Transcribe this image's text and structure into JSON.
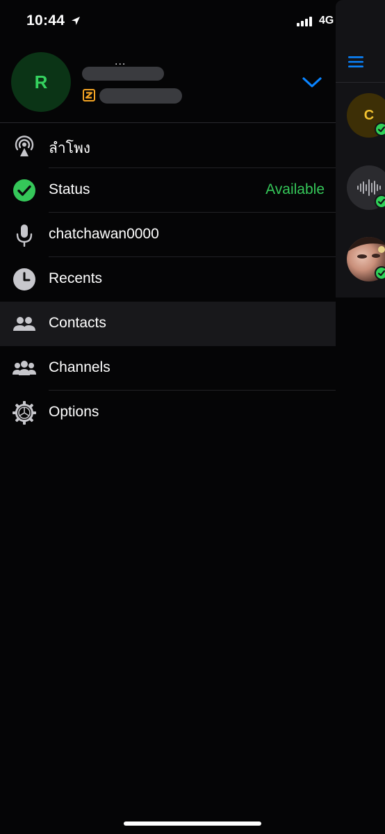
{
  "status_bar": {
    "time": "10:44",
    "network": "4G"
  },
  "profile": {
    "avatar_letter": "R",
    "name_overflow": "...",
    "status_icon": "zoiper-z-icon"
  },
  "menu": {
    "items": [
      {
        "label": "ลำโพง",
        "icon": "speaker-broadcast-icon"
      },
      {
        "label": "Status",
        "value": "Available",
        "icon": "check-circle-icon"
      },
      {
        "label": "chatchawan0000",
        "icon": "microphone-icon"
      },
      {
        "label": "Recents",
        "icon": "clock-icon"
      },
      {
        "label": "Contacts",
        "icon": "contacts-icon"
      },
      {
        "label": "Channels",
        "icon": "group-icon"
      },
      {
        "label": "Options",
        "icon": "gear-icon"
      }
    ]
  },
  "side_panel": {
    "menu_icon": "hamburger-icon",
    "chats": [
      {
        "letter": "C"
      }
    ]
  },
  "colors": {
    "accent_blue": "#0a84ff",
    "available_green": "#35c759",
    "background": "#050506"
  }
}
